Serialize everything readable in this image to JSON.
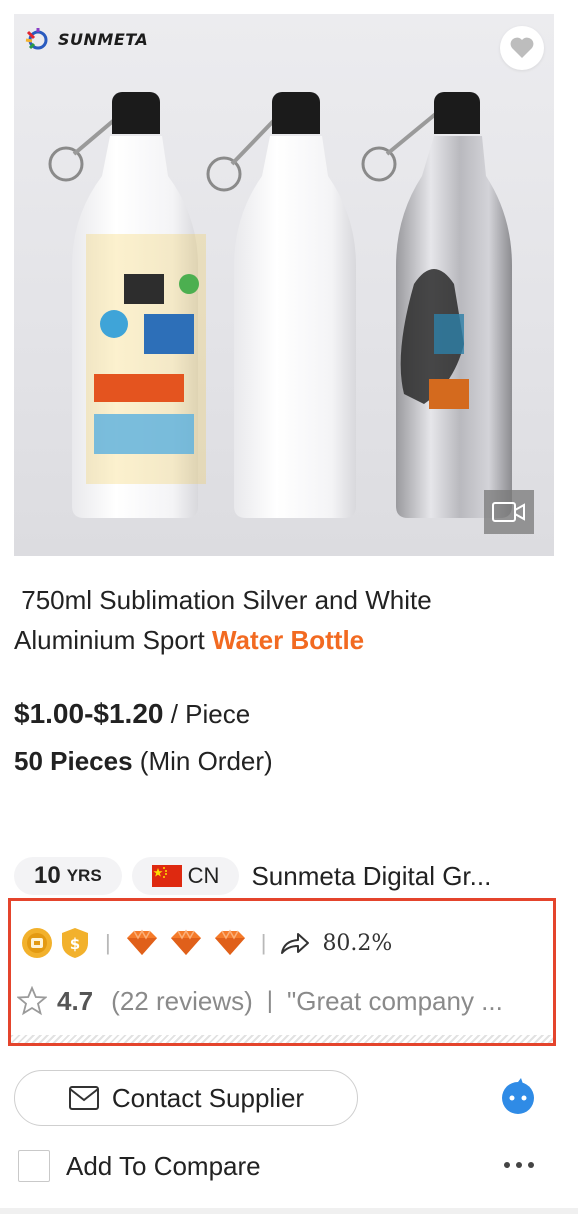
{
  "product": {
    "brand": "SUNMETA",
    "title_plain": " 750ml Sublimation Silver and White Aluminium Sport ",
    "title_highlight": "Water Bottle",
    "price_range": "$1.00-$1.20",
    "price_unit": "/ Piece",
    "min_order_qty": "50 Pieces",
    "min_order_label": "(Min Order)"
  },
  "supplier": {
    "years_num": "10",
    "years_unit": "YRS",
    "country": "CN",
    "name": "Sunmeta Digital Gr..."
  },
  "metrics": {
    "response_rate": "80.2%",
    "rating": "4.7",
    "reviews": "(22 reviews)",
    "separator": "|",
    "review_quote": "\"Great company ..."
  },
  "actions": {
    "contact_label": "Contact Supplier",
    "compare_label": "Add To Compare"
  },
  "colors": {
    "accent": "#f26a21",
    "highlight_border": "#e4442c",
    "chat": "#2f8be6",
    "diamond": "#f57b2a",
    "gold": "#f2b12c"
  }
}
